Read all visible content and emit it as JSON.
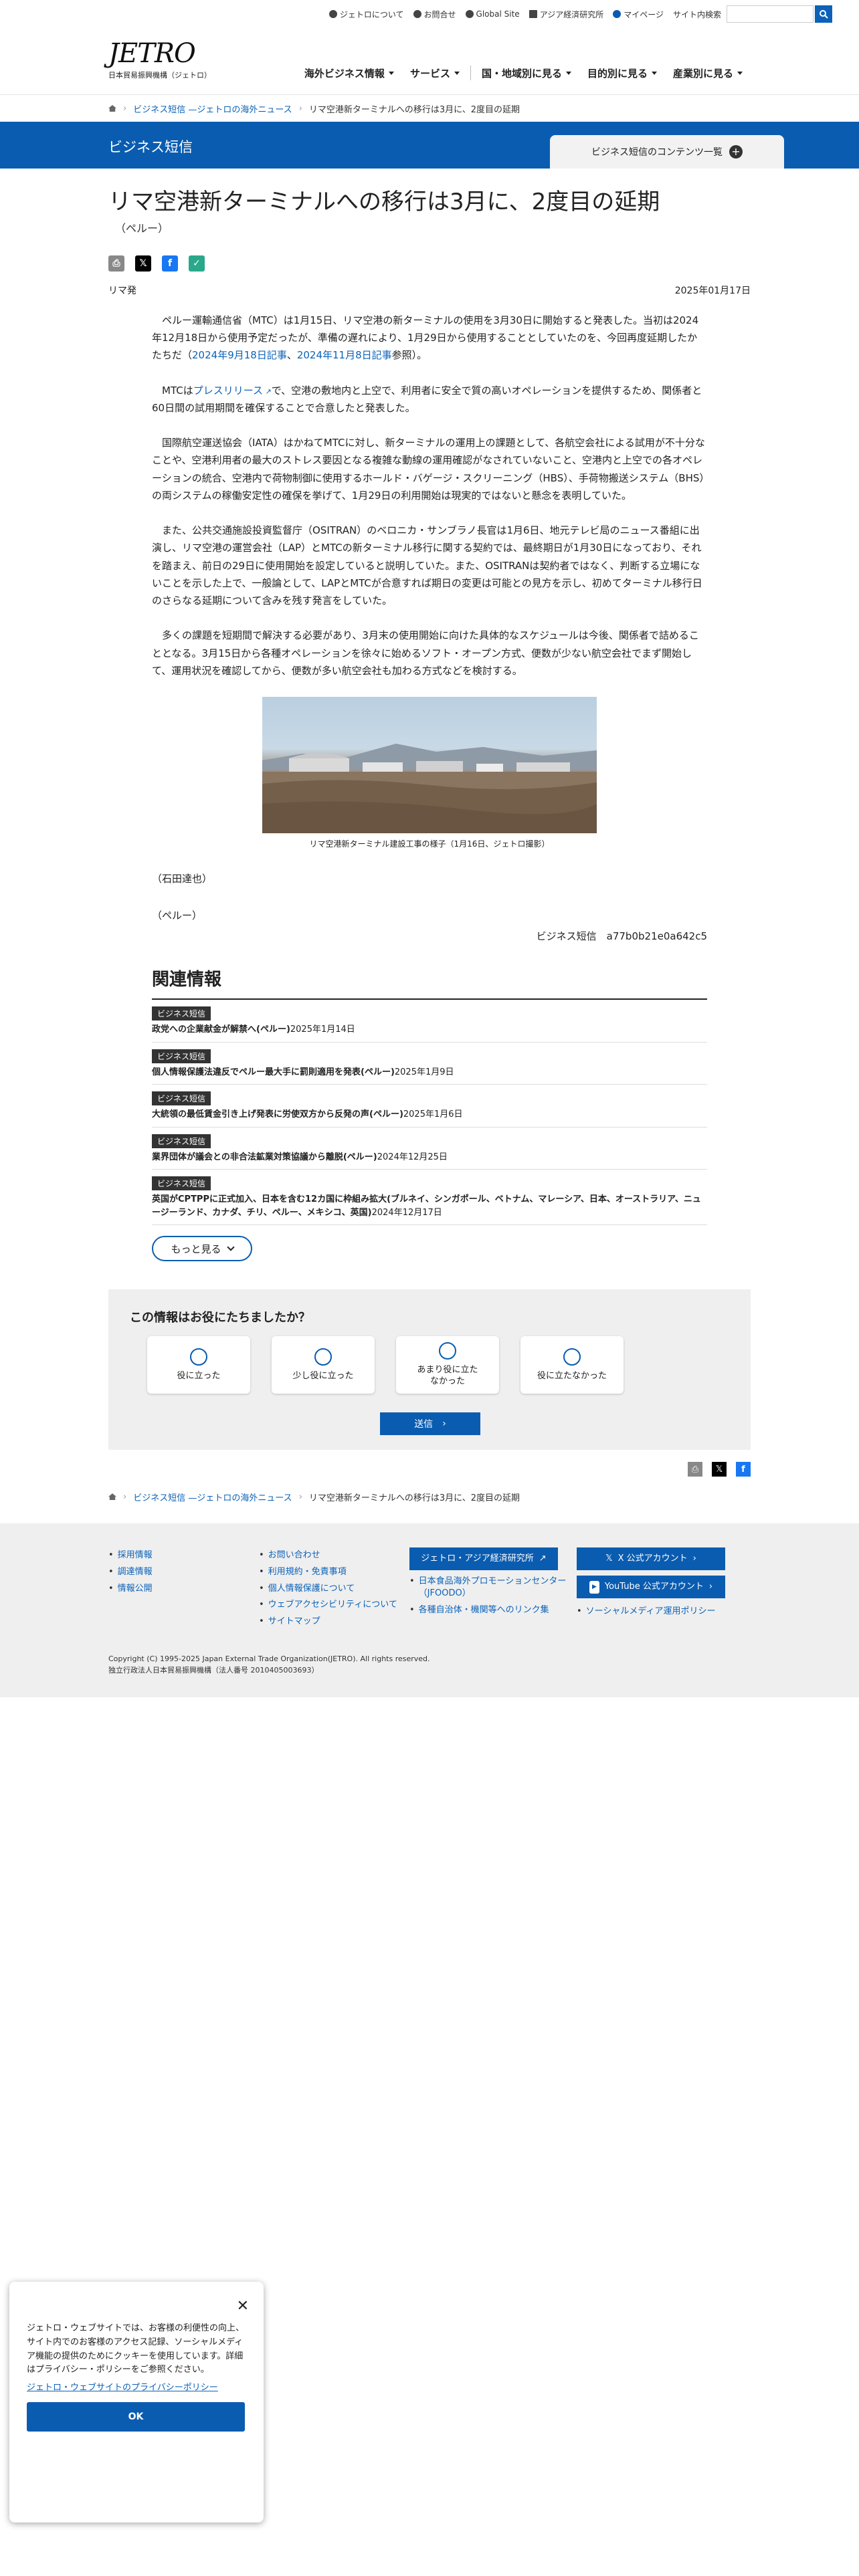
{
  "utility": {
    "about": "ジェトロについて",
    "contact": "お問合せ",
    "global": "Global Site",
    "ide": "アジア経済研究所",
    "mypage": "マイページ",
    "search_label": "サイト内検索",
    "search_placeholder": ""
  },
  "logo": {
    "mark": "JETRO",
    "sub": "日本貿易振興機構（ジェトロ）"
  },
  "gnav": [
    "海外ビジネス情報",
    "サービス",
    "国・地域別に見る",
    "目的別に見る",
    "産業別に見る"
  ],
  "breadcrumb": {
    "level1": "ビジネス短信 —ジェトロの海外ニュース",
    "current": "リマ空港新ターミナルへの移行は3月に、2度目の延期"
  },
  "banner": {
    "title": "ビジネス短信",
    "contents_link": "ビジネス短信のコンテンツ一覧"
  },
  "article": {
    "title": "リマ空港新ターミナルへの移行は3月に、2度目の延期",
    "country": "（ペルー）",
    "place": "リマ発",
    "date": "2025年01月17日",
    "p1a": "ペルー運輸通信省（MTC）は1月15日、リマ空港の新ターミナルの使用を3月30日に開始すると発表した。当初は2024年12月18日から使用予定だったが、準備の遅れにより、1月29日から使用することとしていたのを、今回再度延期したかたちだ（",
    "p1link1": "2024年9月18日記事",
    "p1sep": "、",
    "p1link2": "2024年11月8日記事",
    "p1b": "参照）。",
    "p2a": "MTCは",
    "p2link": "プレスリリース",
    "p2b": "で、空港の敷地内と上空で、利用者に安全で質の高いオペレーションを提供するため、関係者と60日間の試用期間を確保することで合意したと発表した。",
    "p3": "国際航空運送協会（IATA）はかねてMTCに対し、新ターミナルの運用上の課題として、各航空会社による試用が不十分なことや、空港利用者の最大のストレス要因となる複雑な動線の運用確認がなされていないこと、空港内と上空での各オペレーションの統合、空港内で荷物制御に使用するホールド・バゲージ・スクリーニング（HBS）、手荷物搬送システム（BHS）の両システムの稼働安定性の確保を挙げて、1月29日の利用開始は現実的ではないと懸念を表明していた。",
    "p4": "また、公共交通施設投資監督庁（OSITRAN）のベロニカ・サンブラノ長官は1月6日、地元テレビ局のニュース番組に出演し、リマ空港の運営会社（LAP）とMTCの新ターミナル移行に関する契約では、最終期日が1月30日になっており、それを踏まえ、前日の29日に使用開始を設定していると説明していた。また、OSITRANは契約者ではなく、判断する立場にないことを示した上で、一般論として、LAPとMTCが合意すれば期日の変更は可能との見方を示し、初めてターミナル移行日のさらなる延期について含みを残す発言をしていた。",
    "p5": "多くの課題を短期間で解決する必要があり、3月末の使用開始に向けた具体的なスケジュールは今後、関係者で詰めることとなる。3月15日から各種オペレーションを徐々に始めるソフト・オープン方式、便数が少ない航空会社でまず開始して、運用状況を確認してから、便数が多い航空会社も加わる方式などを検討する。",
    "caption": "リマ空港新ターミナル建設工事の様子（1月16日、ジェトロ撮影）",
    "author": "（石田達也）",
    "country_sig": "（ペルー）",
    "code": "ビジネス短信　a77b0b21e0a642c5"
  },
  "related": {
    "heading": "関連情報",
    "badge": "ビジネス短信",
    "items": [
      {
        "title": "政党への企業献金が解禁へ(ペルー)",
        "date": "2025年1月14日"
      },
      {
        "title": "個人情報保護法違反でペルー最大手に罰則適用を発表(ペルー)",
        "date": "2025年1月9日"
      },
      {
        "title": "大統領の最低賃金引き上げ発表に労使双方から反発の声(ペルー)",
        "date": "2025年1月6日"
      },
      {
        "title": "業界団体が議会との非合法鉱業対策協議から離脱(ペルー)",
        "date": "2024年12月25日"
      },
      {
        "title": "英国がCPTPPに正式加入、日本を含む12カ国に枠組み拡大(ブルネイ、シンガポール、ベトナム、マレーシア、日本、オーストラリア、ニュージーランド、カナダ、チリ、ペルー、メキシコ、英国)",
        "date": "2024年12月17日"
      }
    ],
    "more": "もっと見る"
  },
  "feedback": {
    "heading": "この情報はお役にたちましたか？",
    "opt1": "役に立った",
    "opt2": "少し役に立った",
    "opt3a": "あまり役に立た",
    "opt3b": "なかった",
    "opt4": "役に立たなかった",
    "submit": "送信"
  },
  "footer": {
    "col1": [
      "採用情報",
      "調達情報",
      "情報公開"
    ],
    "col2": [
      "お問い合わせ",
      "利用規約・免責事項",
      "個人情報保護について",
      "ウェブアクセシビリティについて",
      "サイトマップ"
    ],
    "col3_btn": "ジェトロ・アジア経済研究所",
    "col3": [
      "日本食品海外プロモーションセンター（JFOODO）",
      "各種自治体・機関等へのリンク集"
    ],
    "col4_btn1": "X 公式アカウント",
    "col4_btn2": "YouTube 公式アカウント",
    "col4": [
      "ソーシャルメディア運用ポリシー"
    ],
    "copyright": "Copyright (C) 1995-2025 Japan External Trade Organization(JETRO). All rights reserved.",
    "corp": "独立行政法人日本貿易振興機構（法人番号 2010405003693）"
  },
  "cookie": {
    "text": "ジェトロ・ウェブサイトでは、お客様の利便性の向上、サイト内でのお客様のアクセス記録、ソーシャルメディア機能の提供のためにクッキーを使用しています。詳細はプライバシー・ポリシーをご参照ください。",
    "link": "ジェトロ・ウェブサイトのプライバシーポリシー",
    "ok": "OK"
  },
  "colors": {
    "brand": "#0a5cb0",
    "link": "#0b62b8"
  }
}
